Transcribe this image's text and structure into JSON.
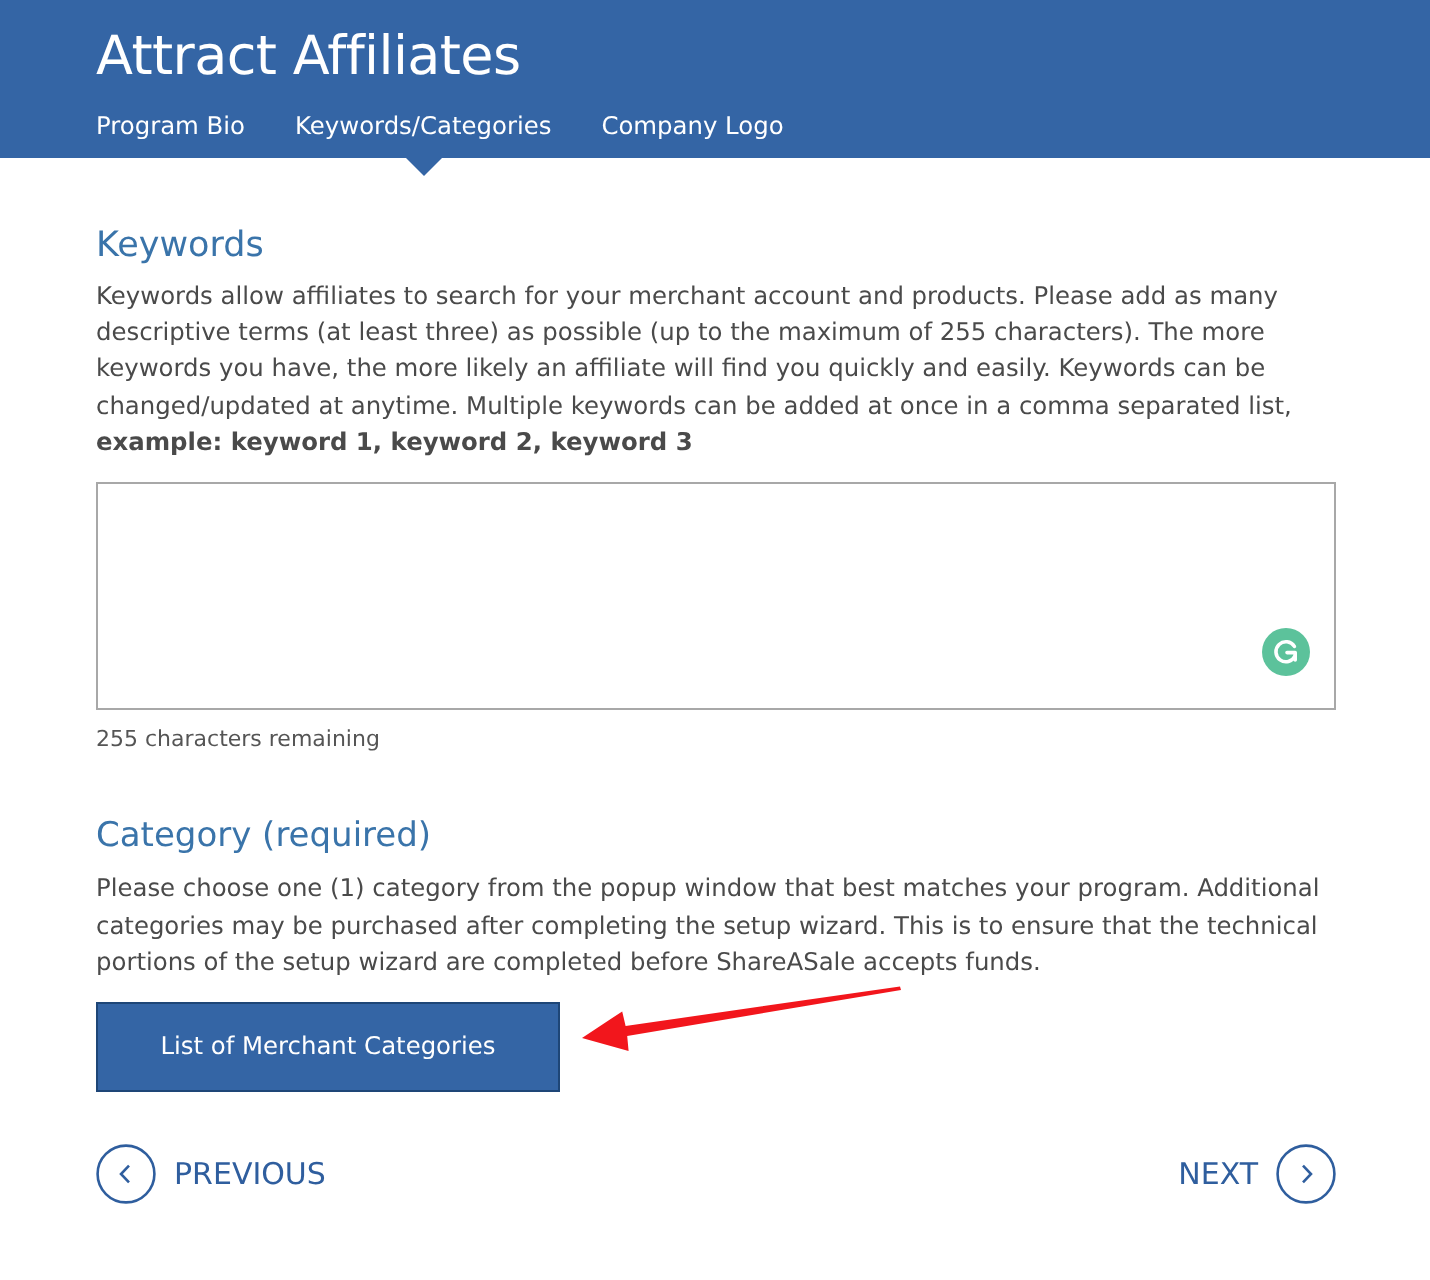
{
  "header": {
    "title": "Attract Affiliates",
    "tabs": [
      {
        "label": "Program Bio",
        "selected": false
      },
      {
        "label": "Keywords/Categories",
        "selected": true
      },
      {
        "label": "Company Logo",
        "selected": false
      }
    ]
  },
  "keywords": {
    "heading": "Keywords",
    "description": "Keywords allow affiliates to search for your merchant account and products. Please add as many descriptive terms (at least three) as possible (up to the maximum of 255 characters). The more keywords you have, the more likely an affiliate will find you quickly and easily. Keywords can be changed/updated at anytime. Multiple keywords can be added at once in a comma separated list, **example: keyword 1, keyword 2, keyword 3**",
    "counter": "255 characters remaining"
  },
  "category": {
    "heading": "Category (required)",
    "description": "Please choose one (1) category from the popup window that best matches your program. Additional categories may be purchased after completing the setup wizard. This is to ensure that the technical portions of the setup wizard are completed before ShareASale accepts funds.",
    "button": "List of Merchant Categories",
    "annotation_arrow": true
  },
  "nav": {
    "previous": "PREVIOUS",
    "next": "NEXT"
  }
}
